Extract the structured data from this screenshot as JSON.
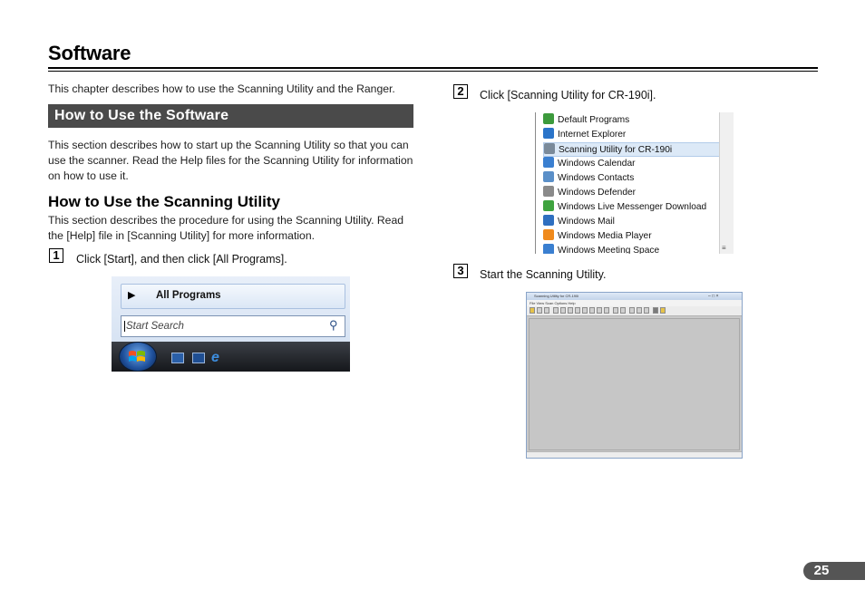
{
  "header": {
    "title": "Software"
  },
  "intro": "This chapter describes how to use the Scanning Utility and the Ranger.",
  "section": {
    "title": "How to Use the Software",
    "desc": "This section describes how to start up the Scanning Utility so that you can use the scanner. Read the Help files for the Scanning Utility for information on how to use it."
  },
  "subsection": {
    "title": "How to Use the Scanning Utility",
    "desc": "This section describes the procedure for using the Scanning Utility. Read the [Help] file in [Scanning Utility] for more information."
  },
  "steps": [
    {
      "num": "1",
      "text": "Click [Start], and then click [All Programs]."
    },
    {
      "num": "2",
      "text": "Click [Scanning Utility for CR-190i]."
    },
    {
      "num": "3",
      "text": "Start the Scanning Utility."
    }
  ],
  "start_menu": {
    "all_programs": "All Programs",
    "search_placeholder": "Start Search"
  },
  "programs_menu": {
    "items": [
      {
        "label": "Default Programs",
        "icon": "default-programs-icon",
        "color": "#3c9a3c"
      },
      {
        "label": "Internet Explorer",
        "icon": "internet-explorer-icon",
        "color": "#2a74c9"
      },
      {
        "label": "Scanning Utility for CR-190i",
        "icon": "scanner-icon",
        "color": "#7a8a9a",
        "selected": true
      },
      {
        "label": "Windows Calendar",
        "icon": "calendar-icon",
        "color": "#3a7fd0"
      },
      {
        "label": "Windows Contacts",
        "icon": "contacts-icon",
        "color": "#5a8fc8"
      },
      {
        "label": "Windows Defender",
        "icon": "defender-icon",
        "color": "#8a8a8a"
      },
      {
        "label": "Windows Live Messenger Download",
        "icon": "messenger-icon",
        "color": "#3fa33f"
      },
      {
        "label": "Windows Mail",
        "icon": "mail-icon",
        "color": "#2f6fc0"
      },
      {
        "label": "Windows Media Player",
        "icon": "media-player-icon",
        "color": "#f08a1c"
      },
      {
        "label": "Windows Meeting Space",
        "icon": "meeting-space-icon",
        "color": "#3a7fd0"
      }
    ]
  },
  "scan_app": {
    "title": "Scanning Utility for CR-190i",
    "menu": "File  View  Scan  Options  Help"
  },
  "page_number": "25"
}
